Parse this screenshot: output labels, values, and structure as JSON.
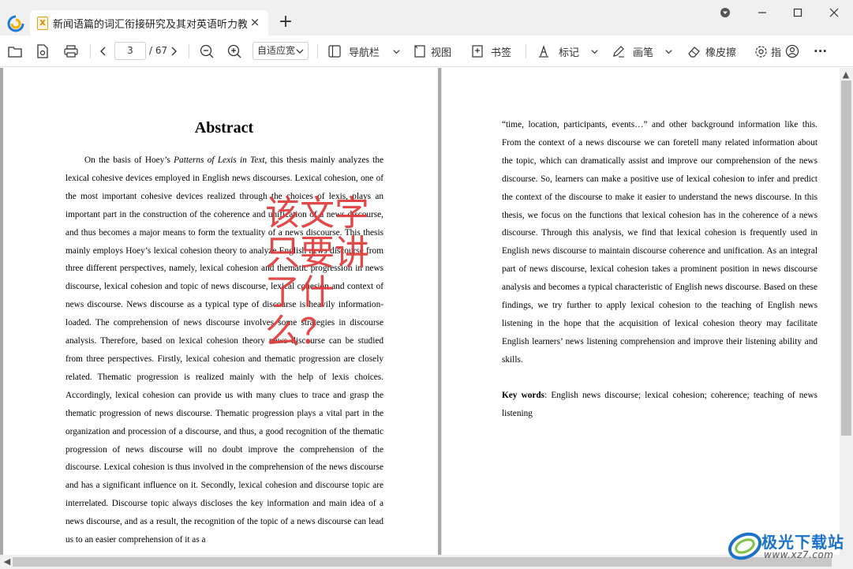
{
  "tab": {
    "icon_letter": "X",
    "title": "新闻语篇的词汇衔接研究及其对英语听力教...",
    "close": "×",
    "new_tab": "+"
  },
  "window": {
    "minimize": "—",
    "maximize": "☐",
    "close": "✕"
  },
  "toolbar": {
    "current_page": "3",
    "total_pages": "/ 67",
    "zoom_mode": "自适应宽",
    "nav_label": "导航栏",
    "view_label": "视图",
    "bookmark_label": "书签",
    "mark_label": "标记",
    "pen_label": "画笔",
    "eraser_label": "橡皮擦",
    "settings_label": "指",
    "more": "···"
  },
  "document": {
    "abstract_title": "Abstract",
    "left_para_prefix": "On the basis of Hoey’s ",
    "left_para_italic": "Patterns of Lexis in Text",
    "left_para_rest": ", this thesis mainly analyzes the lexical cohesive devices employed in English news discourses. Lexical cohesion, one of the most important cohesive devices realized through the choices of lexis, plays an important part in the construction of the coherence and unification of a news discourse, and thus becomes a major means to form the textuality of a news discourse. This thesis mainly employs Hoey’s lexical cohesion theory to analyze English news discourse from three different perspectives, namely, lexical cohesion and thematic progression in news discourse, lexical cohesion and topic of news discourse, lexical cohesion and context of news discourse. News discourse as a typical type of discourse is heavily information-loaded. The comprehension of news discourse involves some strategies in discourse analysis. Therefore, based on lexical cohesion theory news discourse can be studied from three perspectives. Firstly, lexical cohesion and thematic progression are closely related. Thematic progression is realized mainly with the help of lexis choices. Accordingly, lexical cohesion can provide us with many clues to trace and grasp the thematic progression of news discourse. Thematic progression plays a vital part in the organization and procession of a discourse, and thus, a good recognition of the thematic progression of news discourse will no doubt improve the comprehension of the discourse. Lexical cohesion is thus involved in the comprehension of the news discourse and has a significant influence on it. Secondly, lexical cohesion and discourse topic are interrelated. Discourse topic always discloses the key information and main idea of a news discourse, and as a result, the recognition of the topic of a news discourse can lead us to an easier comprehension of it as a",
    "right_para": "“time, location, participants, events…” and other background information like this. From the context of a news discourse we can foretell many related information about the topic, which can dramatically assist and improve our comprehension of the news discourse. So, learners can make a positive use of lexical cohesion to infer and predict the context of the discourse to make it easier to understand the news discourse. In this thesis, we focus on the functions that lexical cohesion has in the coherence of a news discourse. Through this analysis, we find that lexical cohesion is frequently used in English news discourse to maintain discourse coherence and unification. As an integral part of news discourse, lexical cohesion takes a prominent position in news discourse analysis and becomes a typical characteristic of English news discourse. Based on these findings, we try further to apply lexical cohesion to the teaching of English news listening in the hope that the acquisition of lexical cohesion theory may facilitate English learners’ news listening comprehension and improve their listening ability and skills.",
    "keywords_label": "Key words",
    "keywords_text": ": English news discourse; lexical cohesion; coherence; teaching of news listening",
    "annotation_text": "该文字只要讲了什么？"
  },
  "site": {
    "name": "极光下载站",
    "url": "www.xz7.com"
  },
  "colors": {
    "annotation": "#e03a3a",
    "tab_icon": "#d9a21b",
    "site_brand": "#1a72c9"
  }
}
